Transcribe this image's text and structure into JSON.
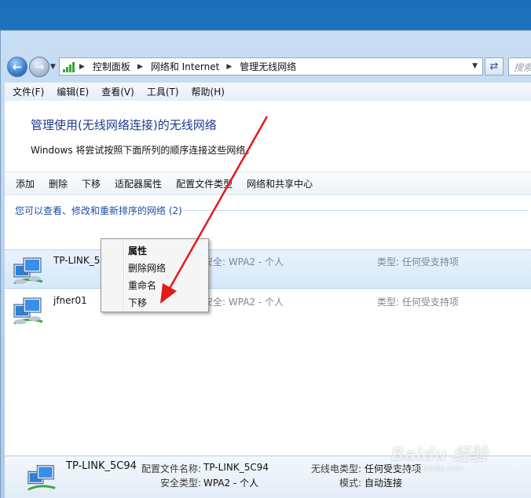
{
  "address": {
    "crumbs": [
      "控制面板",
      "网络和 Internet",
      "管理无线网络"
    ],
    "search_placeholder": "搜索"
  },
  "menu": [
    "文件(F)",
    "编辑(E)",
    "查看(V)",
    "工具(T)",
    "帮助(H)"
  ],
  "page": {
    "title": "管理使用(无线网络连接)的无线网络",
    "description": "Windows 将尝试按照下面所列的顺序连接这些网络。"
  },
  "toolbar": [
    "添加",
    "删除",
    "下移",
    "适配器属性",
    "配置文件类型",
    "网络和共享中心"
  ],
  "group_header": "您可以查看、修改和重新排序的网络 (2)",
  "networks": [
    {
      "name": "TP-LINK_5C94",
      "security": "安全: WPA2 - 个人",
      "type": "类型: 任何受支持项"
    },
    {
      "name": "jfner01",
      "security": "安全: WPA2 - 个人",
      "type": "类型: 任何受支持项"
    }
  ],
  "context_menu": [
    "属性",
    "删除网络",
    "重命名",
    "下移"
  ],
  "details": {
    "name": "TP-LINK_5C94",
    "profile_label": "配置文件名称:",
    "profile_value": "TP-LINK_5C94",
    "security_label": "安全类型:",
    "security_value": "WPA2 - 个人",
    "radio_label": "无线电类型:",
    "radio_value": "任何受支持项",
    "mode_label": "模式:",
    "mode_value": "自动连接"
  },
  "watermark": "Baidu 经验",
  "watermark_url": "jingyan.baidu.com",
  "colors": {
    "accent_blue": "#1e3a8c",
    "arrow_red": "#e21b1b",
    "selection": "#d6e8fa"
  }
}
